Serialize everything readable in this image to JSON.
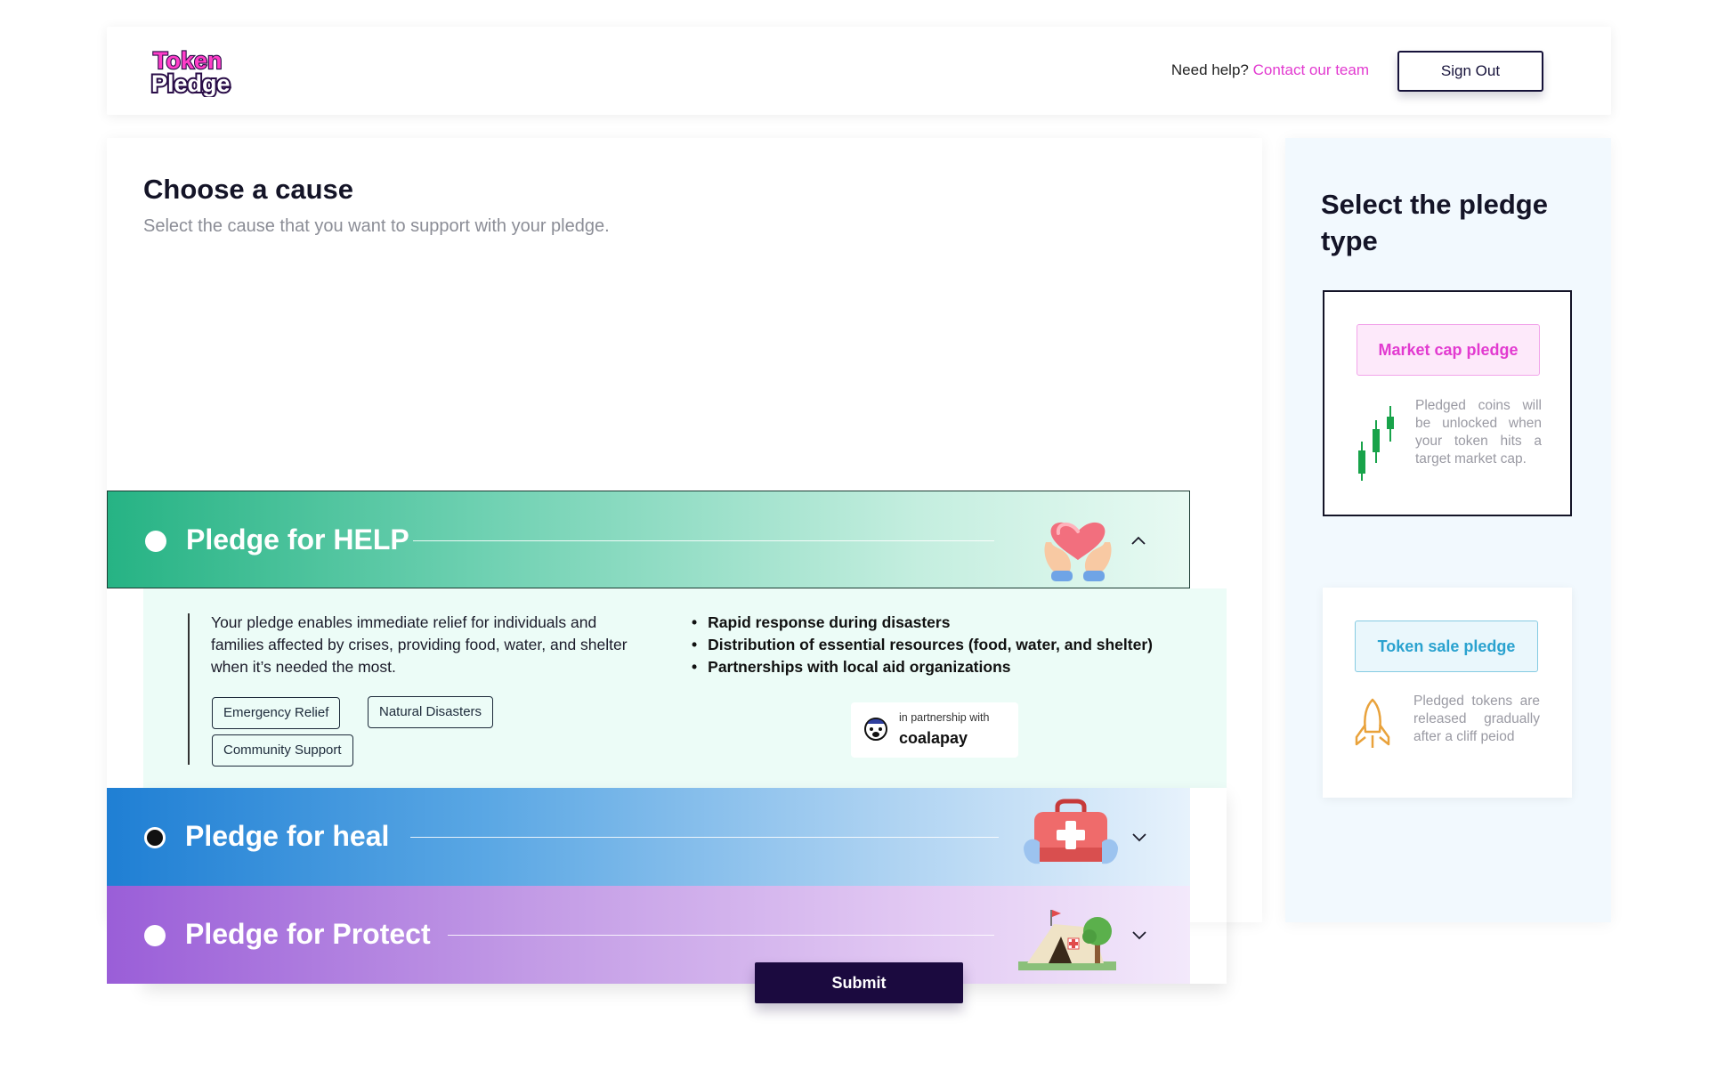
{
  "header": {
    "logo_line1": "Token",
    "logo_line2": "Pledge",
    "help_prefix": "Need help? ",
    "help_link": "Contact our team",
    "signout_label": "Sign Out"
  },
  "main": {
    "title": "Choose a cause",
    "subtitle": "Select the cause that you want to support with your pledge."
  },
  "causes": [
    {
      "label": "Pledge for HELP",
      "expanded": true,
      "description": "Your pledge enables immediate relief for individuals and families affected by crises, providing food, water, and shelter when it’s needed the most.",
      "bullets": [
        "Rapid response during disasters",
        "Distribution of essential resources (food, water, and shelter)",
        "Partnerships with local aid organizations"
      ],
      "tags": [
        "Emergency Relief",
        "Natural Disasters",
        "Community Support"
      ],
      "partner_caption": "in partnership with",
      "partner_name": "coalapay"
    },
    {
      "label": "Pledge for heal",
      "selected": true
    },
    {
      "label": "Pledge for Protect"
    }
  ],
  "sidebar": {
    "title": "Select the pledge type",
    "options": [
      {
        "label": "Market cap pledge",
        "description": "Pledged coins will be unlocked when your token hits a target market cap.",
        "icon": "candlestick-chart-icon"
      },
      {
        "label": "Token sale pledge",
        "description": "Pledged tokens are released gradually after a cliff peiod",
        "icon": "rocket-icon"
      }
    ]
  },
  "submit_label": "Submit",
  "colors": {
    "brand_pink": "#e23ad0",
    "navy": "#1b0a3f",
    "help_green": "#26b384",
    "heal_blue": "#1f7fd4",
    "protect_purple": "#9a5ed8"
  }
}
